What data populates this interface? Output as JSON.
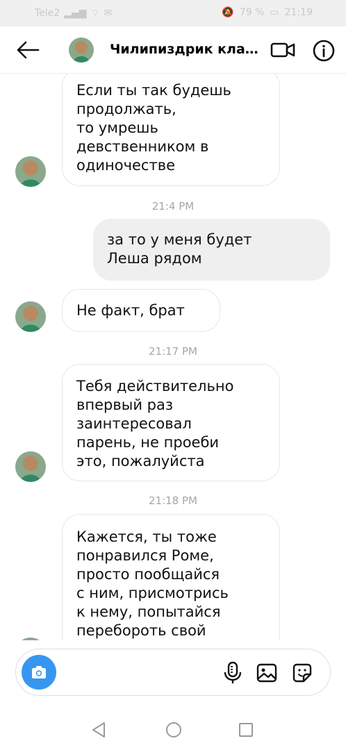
{
  "status_bar": {
    "left_text": "Tele2",
    "battery": "79 %",
    "time": "21:19"
  },
  "header": {
    "title": "Чилипиздрик класс..."
  },
  "messages": [
    {
      "kind": "incoming",
      "text": "Если ты так будешь\nпродолжать,\nто умрешь\nдевственником в\nодиночестве"
    },
    {
      "kind": "timestamp",
      "text": "21:4 PM"
    },
    {
      "kind": "outgoing",
      "text": "за то у меня будет\nЛеша рядом"
    },
    {
      "kind": "incoming",
      "text": "Не факт, брат"
    },
    {
      "kind": "timestamp",
      "text": "21:17 PM"
    },
    {
      "kind": "incoming",
      "text": "Тебя действительно\nвпервый раз\nзаинтересовал\nпарень, не проеби\nэто, пожалуйста"
    },
    {
      "kind": "timestamp",
      "text": "21:18 PM"
    },
    {
      "kind": "incoming",
      "text": "Кажется, ты тоже\nпонравился Роме,\nпросто пообщайся\nс ним, присмотрись\nк нему, попытайся\nперебороть свой"
    }
  ],
  "composer": {
    "placeholder": ""
  },
  "colors": {
    "accent": "#3797f0",
    "bubble_out": "#efefef",
    "bubble_in_border": "#e7e7e7",
    "timestamp": "#a6a6a6"
  },
  "icons": {
    "back": "arrow-left-icon",
    "video": "video-camera-icon",
    "info": "info-icon",
    "camera": "camera-icon",
    "mic": "microphone-icon",
    "gallery": "image-icon",
    "sticker": "sticker-icon"
  }
}
